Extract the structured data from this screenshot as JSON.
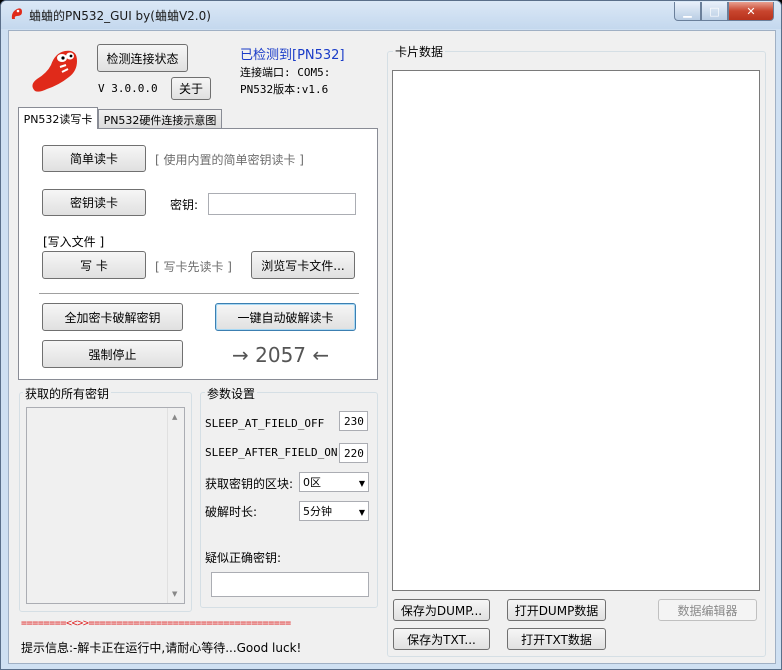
{
  "window": {
    "title": "蛐蛐的PN532_GUI by(蛐蛐V2.0)",
    "min_glyph": "▁",
    "max_glyph": "□",
    "close_glyph": "✕"
  },
  "header": {
    "check_button": "检测连接状态",
    "version": "V 3.0.0.0",
    "about_button": "关于",
    "detected": "已检测到[PN532]",
    "port": "连接端口: COM5:",
    "pn532_version": "PN532版本:v1.6"
  },
  "tabs": [
    {
      "label": "PN532读写卡"
    },
    {
      "label": "PN532硬件连接示意图"
    }
  ],
  "read_write": {
    "simple_read_button": "简单读卡",
    "simple_read_hint": "[ 使用内置的简单密钥读卡 ]",
    "key_read_button": "密钥读卡",
    "key_label": "密钥:",
    "key_value": "",
    "write_file_label": "[写入文件 ]",
    "write_button": "写 卡",
    "write_hint": "[ 写卡先读卡 ]",
    "browse_button": "浏览写卡文件...",
    "crack_all_button": "全加密卡破解密钥",
    "auto_crack_button": "一键自动破解读卡",
    "force_stop_button": "强制停止",
    "counter": "→ 2057 ←"
  },
  "keys_group": {
    "title": "获取的所有密钥",
    "scroll_up": "▲",
    "scroll_down": "▼"
  },
  "params": {
    "title": "参数设置",
    "sleep_off_label": "SLEEP_AT_FIELD_OFF",
    "sleep_off_value": "230",
    "sleep_on_label": "SLEEP_AFTER_FIELD_ON",
    "sleep_on_value": "220",
    "block_label": "获取密钥的区块:",
    "block_value": "0区",
    "duration_label": "破解时长:",
    "duration_value": "5分钟",
    "suspect_key_label": "疑似正确密钥:",
    "suspect_key_value": ""
  },
  "card_data": {
    "title": "卡片数据"
  },
  "bottom_buttons": {
    "save_dump": "保存为DUMP...",
    "open_dump": "打开DUMP数据",
    "data_editor": "数据编辑器",
    "save_txt": "保存为TXT...",
    "open_txt": "打开TXT数据"
  },
  "status": {
    "divider": "========<<>>====================================",
    "message": "提示信息:-解卡正在运行中,请耐心等待...Good luck!"
  },
  "colors": {
    "accent_blue": "#1a3cc8",
    "status_red": "#e02020",
    "logo_red": "#e02a1a"
  }
}
